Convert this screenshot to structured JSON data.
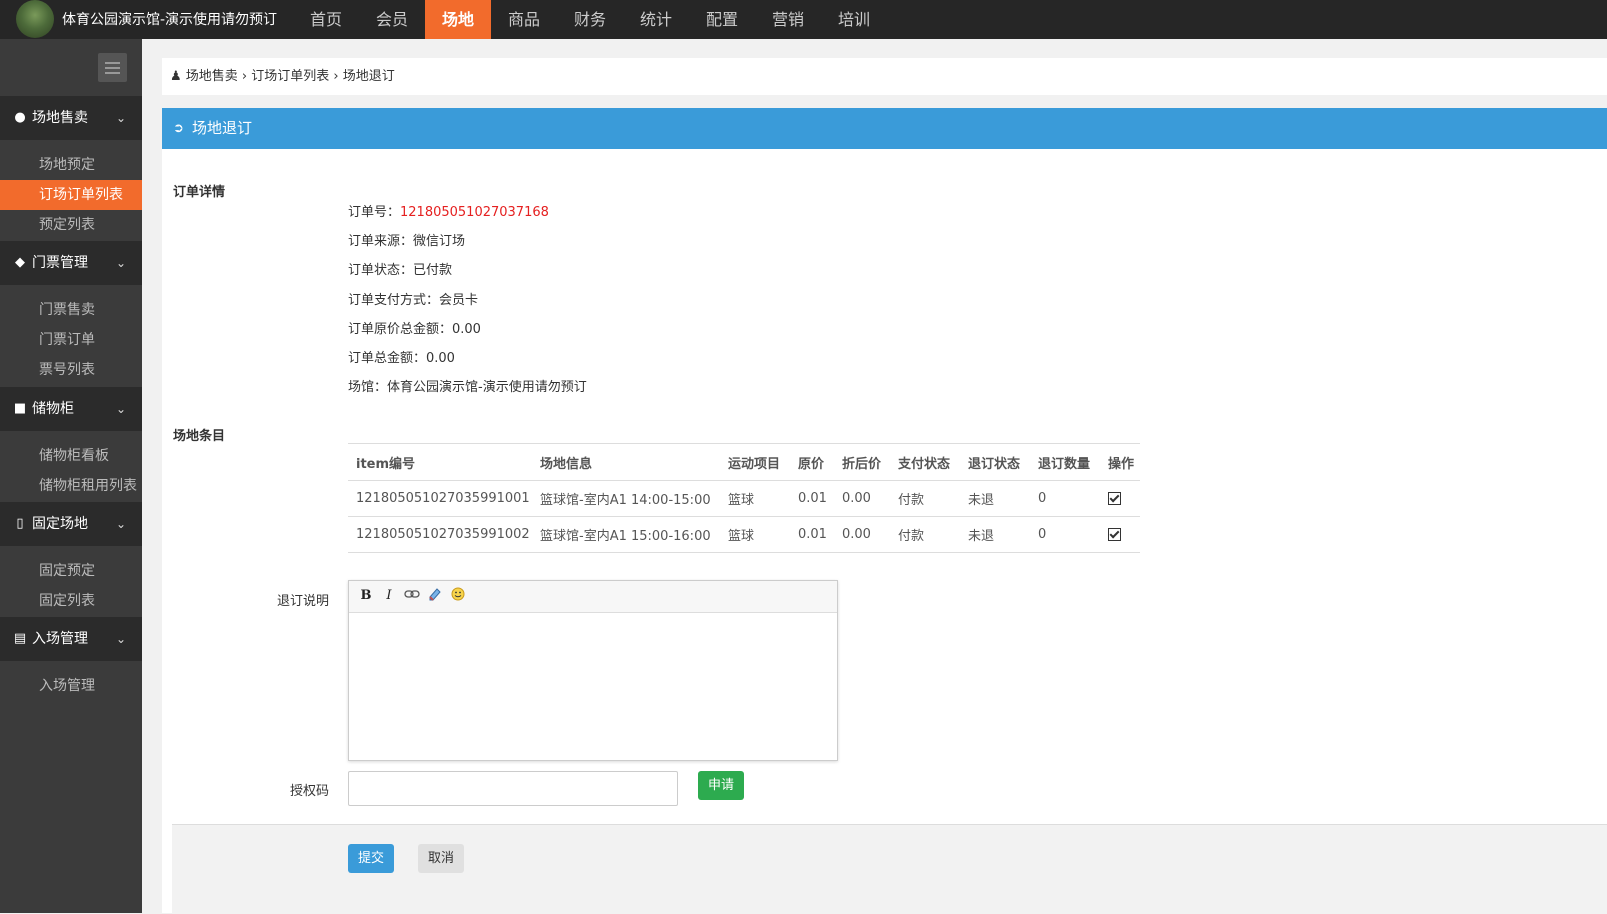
{
  "header": {
    "venue_title": "体育公园演示馆-演示使用请勿预订",
    "nav": [
      {
        "label": "首页"
      },
      {
        "label": "会员"
      },
      {
        "label": "场地"
      },
      {
        "label": "商品"
      },
      {
        "label": "财务"
      },
      {
        "label": "统计"
      },
      {
        "label": "配置"
      },
      {
        "label": "营销"
      },
      {
        "label": "培训"
      }
    ],
    "active_nav": "场地"
  },
  "sidebar": {
    "groups": [
      {
        "label": "场地售卖",
        "icon": "globe-icon",
        "items": [
          {
            "label": "场地预定"
          },
          {
            "label": "订场订单列表"
          },
          {
            "label": "预定列表"
          }
        ]
      },
      {
        "label": "门票管理",
        "icon": "ticket-icon",
        "items": [
          {
            "label": "门票售卖"
          },
          {
            "label": "门票订单"
          },
          {
            "label": "票号列表"
          }
        ]
      },
      {
        "label": "储物柜",
        "icon": "cube-icon",
        "items": [
          {
            "label": "储物柜看板"
          },
          {
            "label": "储物柜租用列表"
          }
        ]
      },
      {
        "label": "固定场地",
        "icon": "bookmark-icon",
        "items": [
          {
            "label": "固定预定"
          },
          {
            "label": "固定列表"
          }
        ]
      },
      {
        "label": "入场管理",
        "icon": "id-card-icon",
        "items": [
          {
            "label": "入场管理"
          }
        ]
      }
    ],
    "active_item": "订场订单列表"
  },
  "breadcrumb": {
    "parts": [
      "场地售卖",
      "订场订单列表",
      "场地退订"
    ],
    "text": "场地售卖 › 订场订单列表 › 场地退订"
  },
  "panel": {
    "title": "场地退订",
    "order_section_label": "订单详情",
    "order": {
      "number_label": "订单号：",
      "number_value": "121805051027037168",
      "source": "订单来源：微信订场",
      "status": "订单状态：已付款",
      "pay_method": "订单支付方式：会员卡",
      "original_total": "订单原价总金额：0.00",
      "total": "订单总金额：0.00",
      "venue": "场馆：体育公园演示馆-演示使用请勿预订"
    },
    "items_section_label": "场地条目",
    "table": {
      "headers": [
        "item编号",
        "场地信息",
        "运动项目",
        "原价",
        "折后价",
        "支付状态",
        "退订状态",
        "退订数量",
        "操作"
      ],
      "rows": [
        [
          "121805051027035991001",
          "篮球馆-室内A1 14:00-15:00",
          "篮球",
          "0.01",
          "0.00",
          "付款",
          "未退",
          "0"
        ],
        [
          "121805051027035991002",
          "篮球馆-室内A1 15:00-16:00",
          "篮球",
          "0.01",
          "0.00",
          "付款",
          "未退",
          "0"
        ]
      ]
    },
    "refund_note_label": "退订说明",
    "editor_tools": [
      "bold-icon",
      "italic-icon",
      "link-icon",
      "eraser-icon",
      "emoji-icon"
    ],
    "editor_bold": "B",
    "editor_italic": "I",
    "auth_code_label": "授权码",
    "auth_code_value": "",
    "apply_button": "申请",
    "submit_button": "提交",
    "cancel_button": "取消"
  }
}
